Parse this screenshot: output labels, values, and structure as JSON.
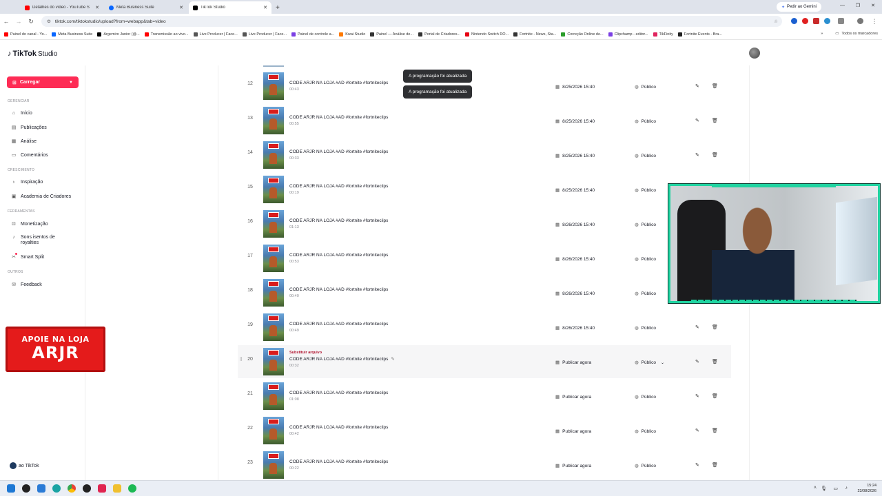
{
  "browser": {
    "tabs": [
      {
        "title": "Detalhes do vídeo - YouTube S",
        "color": "#ff0000",
        "active": false
      },
      {
        "title": "Meta Business Suite",
        "color": "#0866ff",
        "active": false
      },
      {
        "title": "TikTok Studio",
        "color": "#000000",
        "active": true
      }
    ],
    "new_tab": "+",
    "gemini_label": "Pedir ao Gemini",
    "url": "tiktok.com/tiktokstudio/upload?from=webapp&tab=video",
    "bookmarks": [
      {
        "label": "Painel do canal - Yo...",
        "color": "#ff0000"
      },
      {
        "label": "Meta Business Suite",
        "color": "#0866ff"
      },
      {
        "label": "Argemiro Junior (@...",
        "color": "#000000"
      },
      {
        "label": "Transmissão ao vivo...",
        "color": "#ff0000"
      },
      {
        "label": "Live Producer | Face...",
        "color": "#555555"
      },
      {
        "label": "Live Producer | Face...",
        "color": "#555555"
      },
      {
        "label": "Painel de controle a...",
        "color": "#7b3fe4"
      },
      {
        "label": "Kwai Studio",
        "color": "#ff7a00"
      },
      {
        "label": "Painel — Análise de...",
        "color": "#333333"
      },
      {
        "label": "Portal de Criadores...",
        "color": "#333333"
      },
      {
        "label": "Nintendo Switch RO...",
        "color": "#e60012"
      },
      {
        "label": "Fortnite - News, Sta...",
        "color": "#333333"
      },
      {
        "label": "Correção Online de...",
        "color": "#2a9d2a"
      },
      {
        "label": "Clipchamp - editor...",
        "color": "#7b3fe4"
      },
      {
        "label": "TikFinity",
        "color": "#e0245e"
      },
      {
        "label": "Fortnite Events - Bra...",
        "color": "#222222"
      }
    ],
    "bookmarks_more": "»",
    "all_bookmarks": "Todos os marcadores"
  },
  "header": {
    "logo_text": "TikTok",
    "logo_sub": "Studio"
  },
  "sidebar": {
    "upload_label": "Carregar",
    "sections": [
      {
        "title": "Gerenciar",
        "items": [
          {
            "label": "Início",
            "icon": "home-icon"
          },
          {
            "label": "Publicações",
            "icon": "posts-icon"
          },
          {
            "label": "Análise",
            "icon": "analytics-icon"
          },
          {
            "label": "Comentários",
            "icon": "comments-icon"
          }
        ]
      },
      {
        "title": "Crescimento",
        "items": [
          {
            "label": "Inspiração",
            "icon": "bulb-icon"
          },
          {
            "label": "Academia de Criadores",
            "icon": "academy-icon"
          }
        ]
      },
      {
        "title": "Ferramentas",
        "items": [
          {
            "label": "Monetização",
            "icon": "money-icon"
          },
          {
            "label": "Sons isentos de royalties",
            "icon": "music-icon"
          },
          {
            "label": "Smart Split",
            "icon": "split-icon"
          }
        ]
      },
      {
        "title": "Outros",
        "items": [
          {
            "label": "Feedback",
            "icon": "feedback-icon"
          }
        ]
      }
    ],
    "footer_label": "ao TikTok"
  },
  "promo": {
    "line1": "APOIE NA LOJA",
    "line2": "ARJR"
  },
  "toasts": [
    "A programação foi atualizada",
    "A programação foi atualizada"
  ],
  "posts": [
    {
      "num": "12",
      "caption": "CODE ARJR NA LOJA #AD #fortnite #fortniteclips",
      "duration": "00:43",
      "schedule": "8/25/2026 15:40",
      "visibility": "Público"
    },
    {
      "num": "13",
      "caption": "CODE ARJR NA LOJA #AD #fortnite #fortniteclips",
      "duration": "00:55",
      "schedule": "8/25/2026 15:40",
      "visibility": "Público"
    },
    {
      "num": "14",
      "caption": "CODE ARJR NA LOJA #AD #fortnite #fortniteclips",
      "duration": "00:33",
      "schedule": "8/25/2026 15:40",
      "visibility": "Público"
    },
    {
      "num": "15",
      "caption": "CODE ARJR NA LOJA #AD #fortnite #fortniteclips",
      "duration": "00:19",
      "schedule": "8/25/2026 15:40",
      "visibility": "Público"
    },
    {
      "num": "16",
      "caption": "CODE ARJR NA LOJA #AD #fortnite #fortniteclips",
      "duration": "01:13",
      "schedule": "8/26/2026 15:40",
      "visibility": "Público"
    },
    {
      "num": "17",
      "caption": "CODE ARJR NA LOJA #AD #fortnite #fortniteclips",
      "duration": "00:53",
      "schedule": "8/26/2026 15:40",
      "visibility": "Público"
    },
    {
      "num": "18",
      "caption": "CODE ARJR NA LOJA #AD #fortnite #fortniteclips",
      "duration": "00:40",
      "schedule": "8/26/2026 15:40",
      "visibility": "Público"
    },
    {
      "num": "19",
      "caption": "CODE ARJR NA LOJA #AD #fortnite #fortniteclips",
      "duration": "00:49",
      "schedule": "8/26/2026 15:40",
      "visibility": "Público"
    },
    {
      "num": "20",
      "caption": "CODE ARJR NA LOJA #AD #fortnite #fortniteclips",
      "duration": "00:32",
      "schedule": "Publicar agora",
      "visibility": "Público",
      "replace_label": "Substituir arquivo",
      "hover": true
    },
    {
      "num": "21",
      "caption": "CODE ARJR NA LOJA #AD #fortnite #fortniteclips",
      "duration": "01:08",
      "schedule": "Publicar agora",
      "visibility": "Público"
    },
    {
      "num": "22",
      "caption": "CODE ARJR NA LOJA #AD #fortnite #fortniteclips",
      "duration": "00:42",
      "schedule": "Publicar agora",
      "visibility": "Público"
    },
    {
      "num": "23",
      "caption": "CODE ARJR NA LOJA #AD #fortnite #fortniteclips",
      "duration": "00:22",
      "schedule": "Publicar agora",
      "visibility": "Público"
    }
  ],
  "taskbar": {
    "time": "15:24",
    "date": "23/08/2026"
  },
  "colors": {
    "accent": "#fe2c55",
    "replace_link": "#b0122e",
    "cam_frame": "#1fd3a0"
  }
}
